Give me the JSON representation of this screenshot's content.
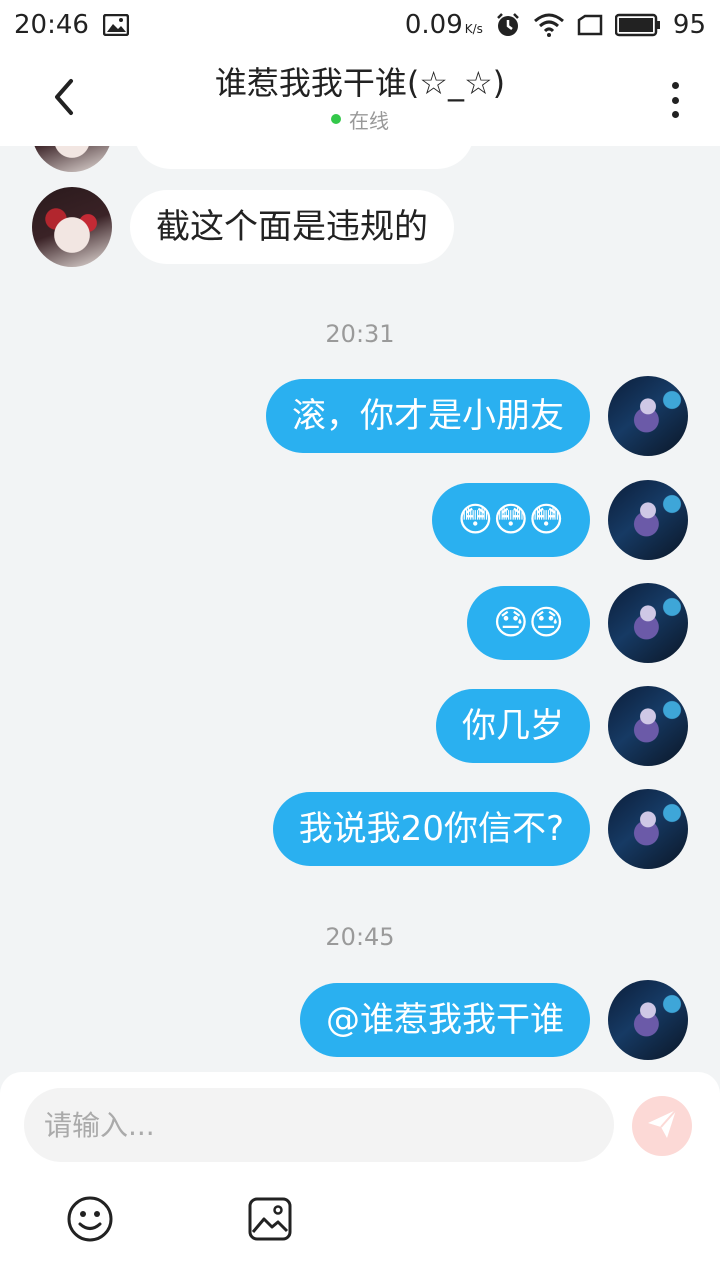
{
  "status_bar": {
    "time": "20:46",
    "net_speed": "0.09",
    "net_unit": "K/s",
    "battery": "95"
  },
  "header": {
    "title": "谁惹我我干谁(☆_☆)",
    "status": "在线"
  },
  "messages": [
    {
      "side": "in",
      "text": "截这个面是违规的"
    },
    {
      "timestamp": "20:31"
    },
    {
      "side": "out",
      "text": "滚，你才是小朋友"
    },
    {
      "side": "out",
      "text": "😳😳😳"
    },
    {
      "side": "out",
      "text": "😓😓"
    },
    {
      "side": "out",
      "text": "你几岁"
    },
    {
      "side": "out",
      "text": "我说我20你信不?"
    },
    {
      "timestamp": "20:45"
    },
    {
      "side": "out",
      "text": "@谁惹我我干谁"
    }
  ],
  "composer": {
    "placeholder": "请输入..."
  },
  "icons": {
    "back": "chevron-left-icon",
    "more": "more-vertical-icon",
    "send": "send-icon",
    "emoji": "emoji-icon",
    "image": "image-icon"
  },
  "colors": {
    "outgoing_bubble": "#2ab0f0",
    "incoming_bubble": "#ffffff",
    "online_dot": "#33c84a",
    "send_button": "#fcd9d6"
  }
}
